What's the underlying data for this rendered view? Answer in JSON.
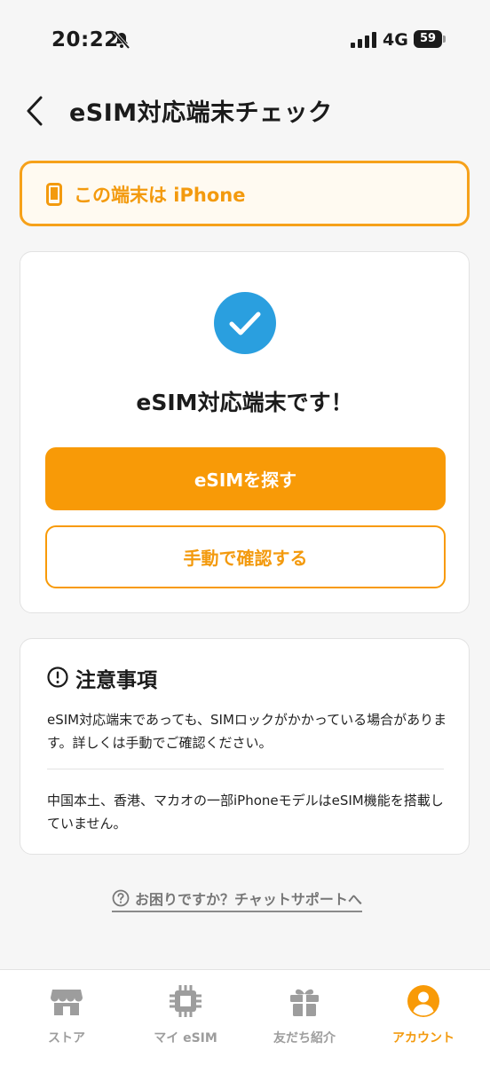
{
  "status_bar": {
    "time": "20:22",
    "network": "4G",
    "battery": "59"
  },
  "header": {
    "title": "eSIM対応端末チェック"
  },
  "device": {
    "label": "この端末は iPhone"
  },
  "result": {
    "message": "eSIM対応端末です！",
    "primary_button": "eSIMを探す",
    "secondary_button": "手動で確認する"
  },
  "notes": {
    "title": "注意事項",
    "items": [
      "eSIM対応端末であっても、SIMロックがかかっている場合があります。詳しくは手動でご確認ください。",
      "中国本土、香港、マカオの一部iPhoneモデルはeSIM機能を搭載していません。"
    ]
  },
  "support": {
    "label": "お困りですか？チャットサポートへ"
  },
  "nav": {
    "items": [
      {
        "label": "ストア",
        "icon": "store-icon",
        "active": false
      },
      {
        "label": "マイ eSIM",
        "icon": "chip-icon",
        "active": false
      },
      {
        "label": "友だち紹介",
        "icon": "gift-icon",
        "active": false
      },
      {
        "label": "アカウント",
        "icon": "account-icon",
        "active": true
      }
    ]
  },
  "colors": {
    "accent": "#f89a07",
    "check": "#2a9fdf",
    "inactive": "#9d9d9d"
  }
}
